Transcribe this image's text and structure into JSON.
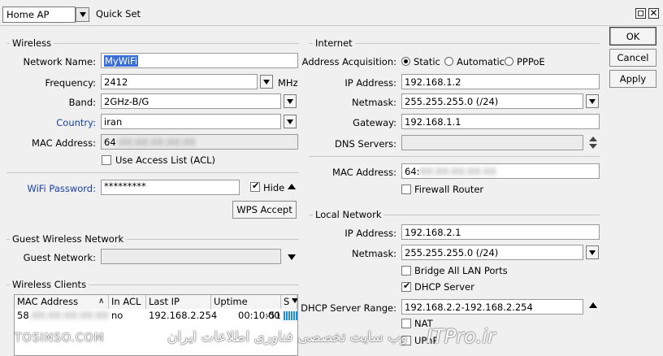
{
  "titlebar": {
    "mode": "Home AP",
    "title": "Quick Set"
  },
  "buttons": {
    "ok": "OK",
    "cancel": "Cancel",
    "apply": "Apply",
    "wps": "WPS Accept"
  },
  "wireless": {
    "group_title": "Wireless",
    "network_name_label": "Network Name:",
    "network_name": "MyWiFi",
    "frequency_label": "Frequency:",
    "frequency": "2412",
    "frequency_unit": "MHz",
    "band_label": "Band:",
    "band": "2GHz-B/G",
    "country_label": "Country:",
    "country": "iran",
    "mac_label": "MAC Address:",
    "mac": "64",
    "mac_blurred": ":XX:XX:XX:XX:XX",
    "acl_label": "Use Access List (ACL)",
    "password_label": "WiFi Password:",
    "password": "*********",
    "hide_label": "Hide"
  },
  "guest": {
    "group_title": "Guest Wireless Network",
    "network_label": "Guest Network:",
    "network": ""
  },
  "clients": {
    "group_title": "Wireless Clients",
    "columns": [
      "MAC Address",
      "In ACL",
      "Last IP",
      "Uptime",
      "S"
    ],
    "rows": [
      {
        "mac": "58",
        "mac_blurred": ":XX:XX:XX:XX:XX",
        "in_acl": "no",
        "last_ip": "192.168.2.254",
        "uptime": "00:10:00",
        "signal": "-51"
      }
    ]
  },
  "internet": {
    "group_title": "Internet",
    "acq_label": "Address Acquisition:",
    "acq_options": [
      "Static",
      "Automatic",
      "PPPoE"
    ],
    "ip_label": "IP Address:",
    "ip": "192.168.1.2",
    "netmask_label": "Netmask:",
    "netmask": "255.255.255.0 (/24)",
    "gateway_label": "Gateway:",
    "gateway": "192.168.1.1",
    "dns_label": "DNS Servers:",
    "dns": "",
    "mac_label": "MAC Address:",
    "mac": "64:",
    "mac_blurred": "XX:XX:XX:XX:XX",
    "firewall_label": "Firewall Router"
  },
  "local": {
    "group_title": "Local Network",
    "ip_label": "IP Address:",
    "ip": "192.168.2.1",
    "netmask_label": "Netmask:",
    "netmask": "255.255.255.0 (/24)",
    "bridge_label": "Bridge All LAN Ports",
    "dhcp_label": "DHCP Server",
    "dhcp_range_label": "DHCP Server Range:",
    "dhcp_range": "192.168.2.2-192.168.2.254",
    "nat_label": "NAT",
    "upnp_label": "UPnP"
  },
  "watermarks": {
    "left": "TOSINSO.COM",
    "center": "وب سایت تخصصی فناوری اطلاعات ایران",
    "right": "ITPro.ir"
  }
}
